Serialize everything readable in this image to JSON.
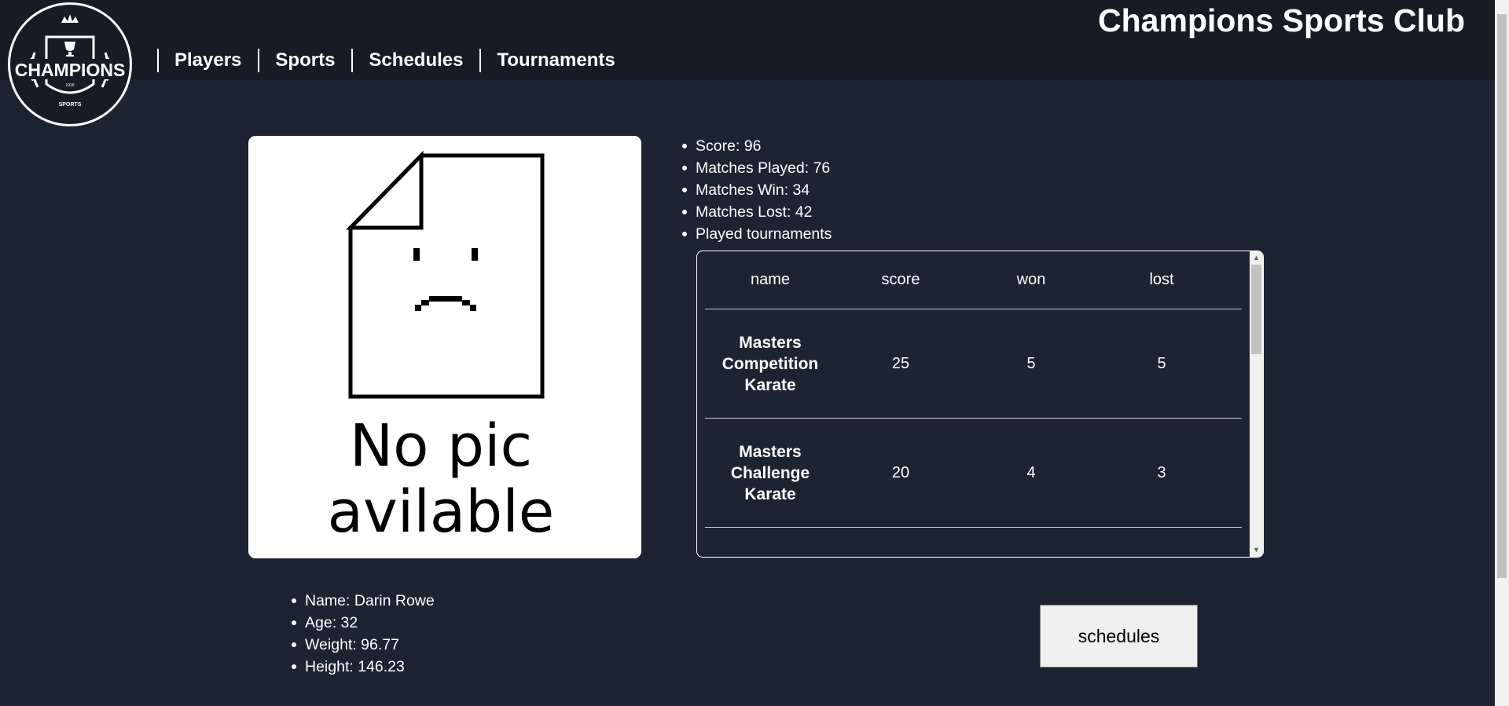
{
  "header": {
    "site_title": "Champions Sports Club",
    "logo_text": "CHAMPIONS",
    "logo_sub": "SPORTS",
    "logo_year": "1916",
    "nav": [
      {
        "label": "Players"
      },
      {
        "label": "Sports"
      },
      {
        "label": "Schedules"
      },
      {
        "label": "Tournaments"
      }
    ]
  },
  "picture": {
    "line1": "No pic",
    "line2": "avilable"
  },
  "stats": [
    "Score: 96",
    "Matches Played: 76",
    "Matches Win: 34",
    "Matches Lost: 42",
    "Played tournaments"
  ],
  "tournaments_table": {
    "headers": [
      "name",
      "score",
      "won",
      "lost"
    ],
    "rows": [
      {
        "name": "Masters Competition Karate",
        "score": "25",
        "won": "5",
        "lost": "5"
      },
      {
        "name": "Masters Challenge Karate",
        "score": "20",
        "won": "4",
        "lost": "3"
      }
    ]
  },
  "player_info": [
    "Name: Darin Rowe",
    "Age: 32",
    "Weight: 96.77",
    "Height: 146.23"
  ],
  "schedules_button": "schedules",
  "colors": {
    "background": "#1c2331",
    "header": "#171c24",
    "text": "#ffffff",
    "button": "#efefef"
  }
}
